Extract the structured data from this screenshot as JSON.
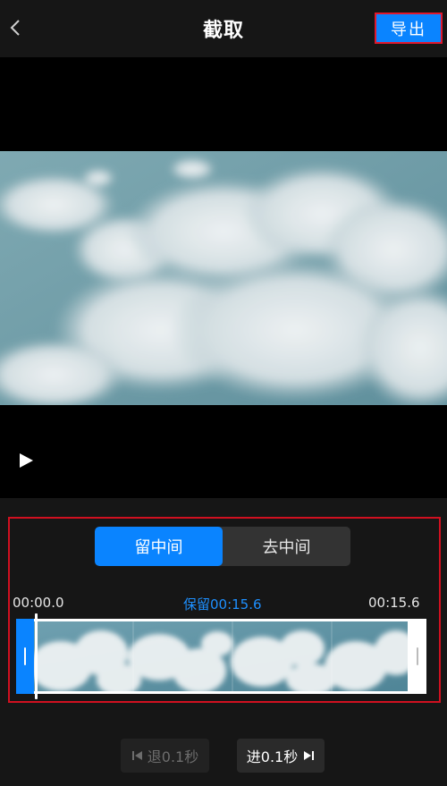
{
  "header": {
    "back_icon": "chevron-left-icon",
    "title": "截取",
    "export_label": "导出"
  },
  "preview": {
    "play_icon": "play-icon"
  },
  "editor": {
    "modes": [
      {
        "label": "留中间",
        "active": true
      },
      {
        "label": "去中间",
        "active": false
      }
    ],
    "time_start": "00:00.0",
    "time_keep": "保留00:15.6",
    "time_end": "00:15.6",
    "step_back_label": "退0.1秒",
    "step_forward_label": "进0.1秒"
  },
  "colors": {
    "accent": "#0a84ff",
    "highlight_border": "#e0182d",
    "background": "#161616"
  }
}
